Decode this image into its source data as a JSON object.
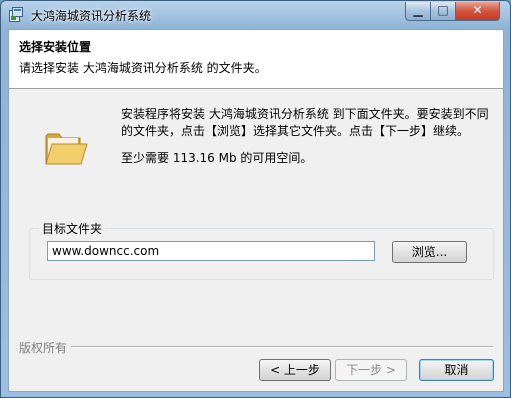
{
  "window": {
    "title": "大鸿海城资讯分析系统",
    "min_glyph": "▁",
    "max_glyph": "□",
    "close_glyph": "✕"
  },
  "header": {
    "title": "选择安装位置",
    "subtitle": "请选择安装 大鸿海城资讯分析系统 的文件夹。"
  },
  "body": {
    "description": "安装程序将安装 大鸿海城资讯分析系统 到下面文件夹。要安装到不同的文件夹，点击【浏览】选择其它文件夹。点击【下一步】继续。",
    "space_required": "至少需要 113.16 Mb 的可用空间。"
  },
  "destination": {
    "group_label": "目标文件夹",
    "path_value": "www.downcc.com",
    "browse_label": "浏览..."
  },
  "footer": {
    "brand": "版权所有",
    "back_label": "< 上一步",
    "next_label": "下一步 >",
    "cancel_label": "取消"
  },
  "icons": {
    "folder": "folder-icon",
    "app": "installer-icon"
  }
}
